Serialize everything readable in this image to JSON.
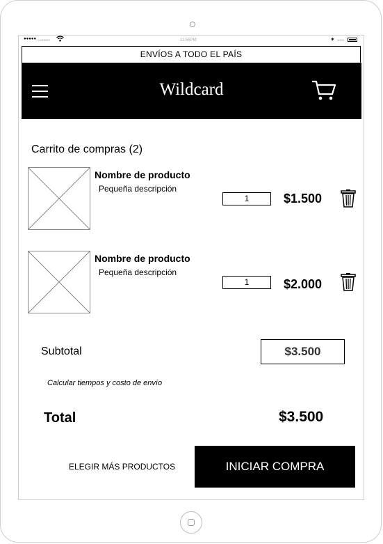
{
  "status_bar": {
    "signal": "●●●●●",
    "carrier": "CARRIER",
    "time": "11:55PM",
    "battery_label": "100%"
  },
  "banner": {
    "text": "ENVÍOS A TODO EL PAÍS"
  },
  "header": {
    "brand": "Wildcard",
    "menu_icon": "hamburger-menu-icon",
    "cart_icon": "shopping-cart-icon"
  },
  "cart": {
    "title": "Carrito de compras (2)",
    "items": [
      {
        "name": "Nombre de producto",
        "description": "Pequeña descripción",
        "quantity": "1",
        "price": "$1.500"
      },
      {
        "name": "Nombre de producto",
        "description": "Pequeña descripción",
        "quantity": "1",
        "price": "$2.000"
      }
    ]
  },
  "summary": {
    "subtotal_label": "Subtotal",
    "subtotal_value": "$3.500",
    "shipping_link": "Calcular tiempos y costo de envío",
    "total_label": "Total",
    "total_value": "$3.500"
  },
  "actions": {
    "more_products": "ELEGIR MÁS PRODUCTOS",
    "checkout": "INICIAR COMPRA"
  },
  "colors": {
    "header_bg": "#000000",
    "button_bg": "#000000",
    "button_text": "#ffffff"
  }
}
